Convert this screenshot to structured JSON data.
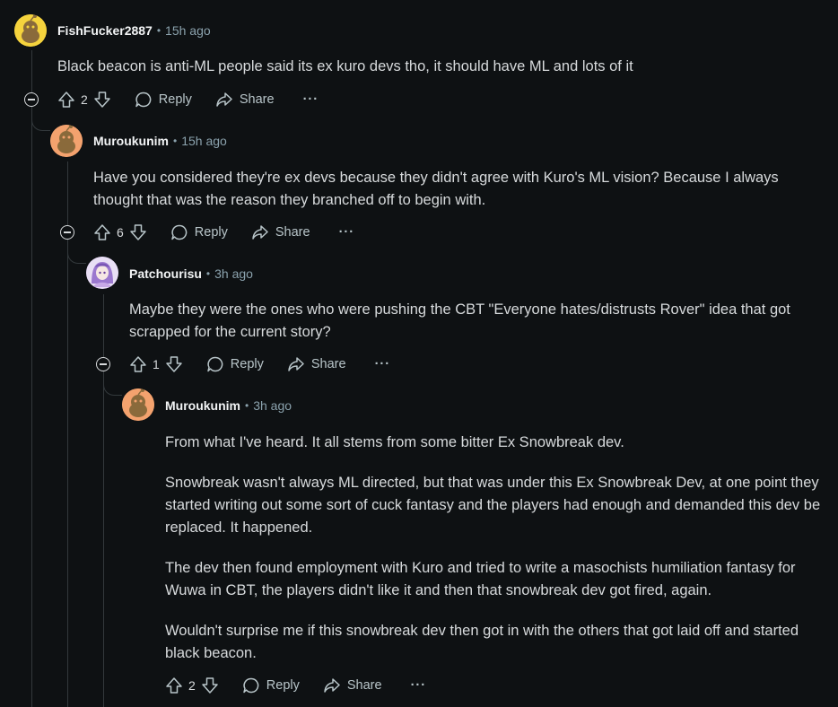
{
  "comments": [
    {
      "author": "FishFucker2887",
      "time": "15h ago",
      "body": [
        "Black beacon is anti-ML people said its ex kuro devs tho, it should have ML and lots of it"
      ],
      "votes": "2",
      "avatar_color": "#f5d33d"
    },
    {
      "author": "Muroukunim",
      "time": "15h ago",
      "body": [
        "Have you considered they're ex devs because they didn't agree with Kuro's ML vision? Because I always thought that was the reason they branched off to begin with."
      ],
      "votes": "6",
      "avatar_color": "#f3a26e"
    },
    {
      "author": "Patchourisu",
      "time": "3h ago",
      "body": [
        "Maybe they were the ones who were pushing the CBT \"Everyone hates/distrusts Rover\" idea that got scrapped for the current story?"
      ],
      "votes": "1",
      "avatar_color": "#c9b3e8"
    },
    {
      "author": "Muroukunim",
      "time": "3h ago",
      "body": [
        "From what I've heard. It all stems from some bitter Ex Snowbreak dev.",
        "Snowbreak wasn't always ML directed, but that was under this Ex Snowbreak Dev, at one point they started writing out some sort of cuck fantasy and the players had enough and demanded this dev be replaced. It happened.",
        "The dev then found employment with Kuro and tried to write a masochists humiliation fantasy for Wuwa in CBT, the players didn't like it and then that snowbreak dev got fired, again.",
        "Wouldn't surprise me if this snowbreak dev then got in with the others that got laid off and started black beacon."
      ],
      "votes": "2",
      "avatar_color": "#f3a26e"
    }
  ],
  "labels": {
    "separator": "•",
    "reply": "Reply",
    "share": "Share",
    "more": "···"
  },
  "icons": [
    "upvote-icon",
    "downvote-icon",
    "reply-icon",
    "share-icon",
    "collapse-icon",
    "more-icon"
  ]
}
